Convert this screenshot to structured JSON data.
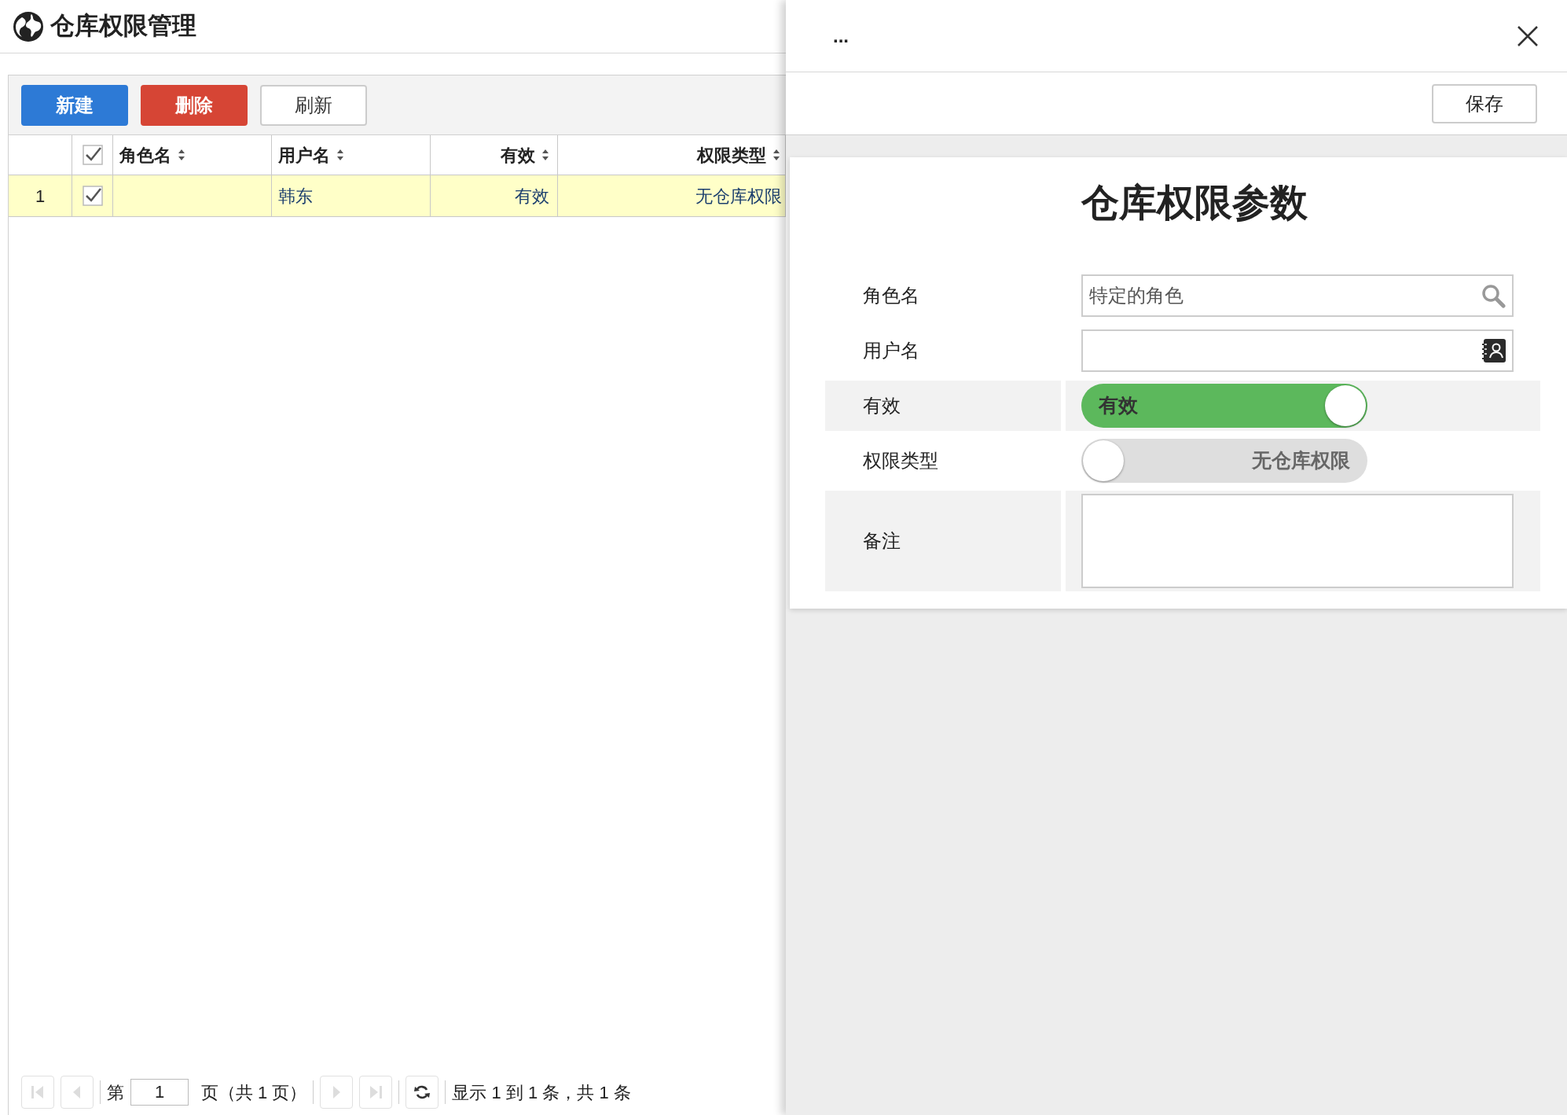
{
  "header": {
    "title": "仓库权限管理"
  },
  "toolbar": {
    "buttons": [
      {
        "label": "新建",
        "kind": "primary"
      },
      {
        "label": "删除",
        "kind": "danger"
      },
      {
        "label": "刷新",
        "kind": "default"
      }
    ]
  },
  "table": {
    "select_all_checked": true,
    "columns": [
      {
        "label": "角色名",
        "sortable": true
      },
      {
        "label": "用户名",
        "sortable": true
      },
      {
        "label": "有效",
        "sortable": true
      },
      {
        "label": "权限类型",
        "sortable": true
      }
    ],
    "rows": [
      {
        "number": "1",
        "checked": true,
        "selected": true,
        "cells": [
          null,
          "韩东",
          "有效",
          "无仓库权限"
        ]
      }
    ]
  },
  "pagination": {
    "page_prefix": "第",
    "page": "1",
    "page_suffix": "页（共 1 页）",
    "summary": "显示 1 到 1 条，共 1 条"
  },
  "panel": {
    "title": "...",
    "save_button": "保存",
    "form_title": "仓库权限参数",
    "fields": [
      {
        "label": "角色名",
        "kind": "search",
        "value": "特定的角色",
        "shaded": false
      },
      {
        "label": "用户名",
        "kind": "contact",
        "shaded": false
      },
      {
        "label": "有效",
        "kind": "toggle",
        "on": true,
        "text": "有效",
        "shaded": true
      },
      {
        "label": "权限类型",
        "kind": "toggle",
        "on": false,
        "text": "无仓库权限",
        "shaded": false
      },
      {
        "label": "备注",
        "kind": "textarea",
        "shaded": true
      }
    ]
  }
}
